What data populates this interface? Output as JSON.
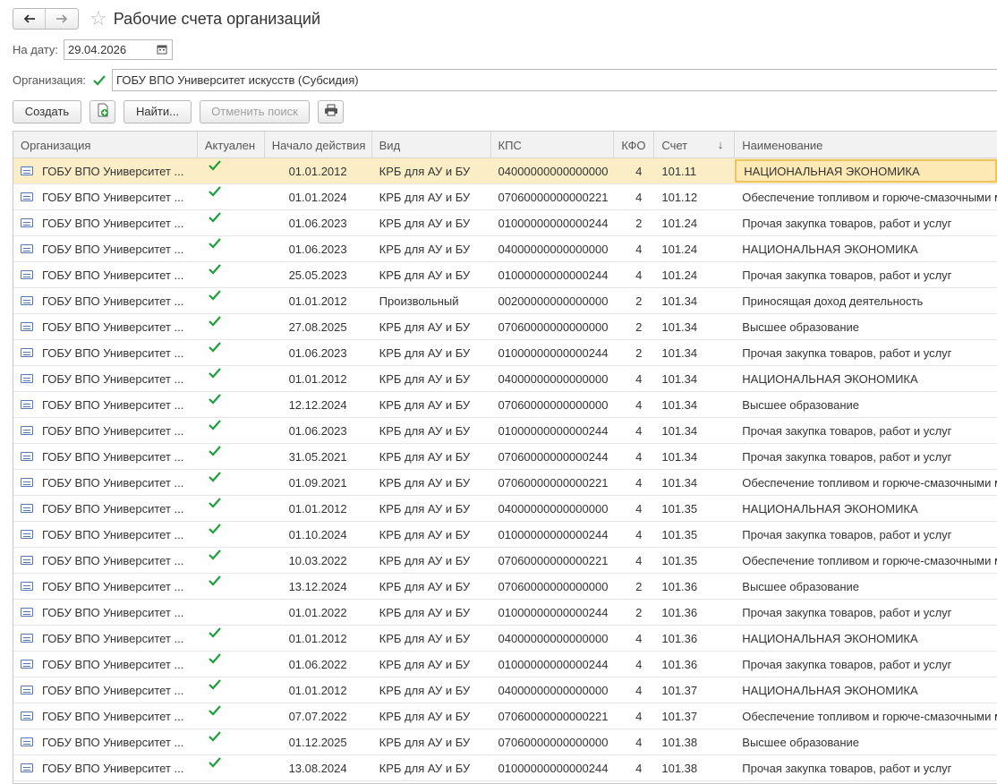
{
  "window": {
    "title": "Рабочие счета организаций"
  },
  "filters": {
    "date_label": "На дату:",
    "date_value": "29.04.2026",
    "org_label": "Организация:",
    "org_value": "ГОБУ ВПО Университет искусств (Субсидия)"
  },
  "toolbar": {
    "create_label": "Создать",
    "find_label": "Найти...",
    "cancel_search_label": "Отменить поиск"
  },
  "table": {
    "columns": [
      "Организация",
      "Актуален",
      "Начало действия",
      "Вид",
      "КПС",
      "КФО",
      "Счет",
      "Наименование"
    ],
    "sort_indicator": "↓",
    "rows": [
      {
        "org": "ГОБУ ВПО Университет ...",
        "active": true,
        "date": "01.01.2012",
        "vid": "КРБ для АУ и БУ",
        "kps": "04000000000000000",
        "kfo": "4",
        "acc": "101.11",
        "name": "НАЦИОНАЛЬНАЯ ЭКОНОМИКА"
      },
      {
        "org": "ГОБУ ВПО Университет ...",
        "active": true,
        "date": "01.01.2024",
        "vid": "КРБ для АУ и БУ",
        "kps": "07060000000000221",
        "kfo": "4",
        "acc": "101.12",
        "name": "Обеспечение топливом и горюче-смазочными м"
      },
      {
        "org": "ГОБУ ВПО Университет ...",
        "active": true,
        "date": "01.06.2023",
        "vid": "КРБ для АУ и БУ",
        "kps": "01000000000000244",
        "kfo": "2",
        "acc": "101.24",
        "name": "Прочая закупка товаров, работ и услуг"
      },
      {
        "org": "ГОБУ ВПО Университет ...",
        "active": true,
        "date": "01.06.2023",
        "vid": "КРБ для АУ и БУ",
        "kps": "04000000000000000",
        "kfo": "4",
        "acc": "101.24",
        "name": "НАЦИОНАЛЬНАЯ ЭКОНОМИКА"
      },
      {
        "org": "ГОБУ ВПО Университет ...",
        "active": true,
        "date": "25.05.2023",
        "vid": "КРБ для АУ и БУ",
        "kps": "01000000000000244",
        "kfo": "4",
        "acc": "101.24",
        "name": "Прочая закупка товаров, работ и услуг"
      },
      {
        "org": "ГОБУ ВПО Университет ...",
        "active": true,
        "date": "01.01.2012",
        "vid": "Произвольный",
        "kps": "00200000000000000",
        "kfo": "2",
        "acc": "101.34",
        "name": "Приносящая доход деятельность"
      },
      {
        "org": "ГОБУ ВПО Университет ...",
        "active": true,
        "date": "27.08.2025",
        "vid": "КРБ для АУ и БУ",
        "kps": "07060000000000000",
        "kfo": "2",
        "acc": "101.34",
        "name": "Высшее образование"
      },
      {
        "org": "ГОБУ ВПО Университет ...",
        "active": true,
        "date": "01.06.2023",
        "vid": "КРБ для АУ и БУ",
        "kps": "01000000000000244",
        "kfo": "2",
        "acc": "101.34",
        "name": "Прочая закупка товаров, работ и услуг"
      },
      {
        "org": "ГОБУ ВПО Университет ...",
        "active": true,
        "date": "01.01.2012",
        "vid": "КРБ для АУ и БУ",
        "kps": "04000000000000000",
        "kfo": "4",
        "acc": "101.34",
        "name": "НАЦИОНАЛЬНАЯ ЭКОНОМИКА"
      },
      {
        "org": "ГОБУ ВПО Университет ...",
        "active": true,
        "date": "12.12.2024",
        "vid": "КРБ для АУ и БУ",
        "kps": "07060000000000000",
        "kfo": "4",
        "acc": "101.34",
        "name": "Высшее образование"
      },
      {
        "org": "ГОБУ ВПО Университет ...",
        "active": true,
        "date": "01.06.2023",
        "vid": "КРБ для АУ и БУ",
        "kps": "01000000000000244",
        "kfo": "4",
        "acc": "101.34",
        "name": "Прочая закупка товаров, работ и услуг"
      },
      {
        "org": "ГОБУ ВПО Университет ...",
        "active": true,
        "date": "31.05.2021",
        "vid": "КРБ для АУ и БУ",
        "kps": "07060000000000244",
        "kfo": "4",
        "acc": "101.34",
        "name": "Прочая закупка товаров, работ и услуг"
      },
      {
        "org": "ГОБУ ВПО Университет ...",
        "active": true,
        "date": "01.09.2021",
        "vid": "КРБ для АУ и БУ",
        "kps": "07060000000000221",
        "kfo": "4",
        "acc": "101.34",
        "name": "Обеспечение топливом и горюче-смазочными м"
      },
      {
        "org": "ГОБУ ВПО Университет ...",
        "active": true,
        "date": "01.01.2012",
        "vid": "КРБ для АУ и БУ",
        "kps": "04000000000000000",
        "kfo": "4",
        "acc": "101.35",
        "name": "НАЦИОНАЛЬНАЯ ЭКОНОМИКА"
      },
      {
        "org": "ГОБУ ВПО Университет ...",
        "active": true,
        "date": "01.10.2024",
        "vid": "КРБ для АУ и БУ",
        "kps": "01000000000000244",
        "kfo": "4",
        "acc": "101.35",
        "name": "Прочая закупка товаров, работ и услуг"
      },
      {
        "org": "ГОБУ ВПО Университет ...",
        "active": true,
        "date": "10.03.2022",
        "vid": "КРБ для АУ и БУ",
        "kps": "07060000000000221",
        "kfo": "4",
        "acc": "101.35",
        "name": "Обеспечение топливом и горюче-смазочными м"
      },
      {
        "org": "ГОБУ ВПО Университет ...",
        "active": true,
        "date": "13.12.2024",
        "vid": "КРБ для АУ и БУ",
        "kps": "07060000000000000",
        "kfo": "2",
        "acc": "101.36",
        "name": "Высшее образование"
      },
      {
        "org": "ГОБУ ВПО Университет ...",
        "active": false,
        "date": "01.01.2022",
        "vid": "КРБ для АУ и БУ",
        "kps": "01000000000000244",
        "kfo": "2",
        "acc": "101.36",
        "name": "Прочая закупка товаров, работ и услуг"
      },
      {
        "org": "ГОБУ ВПО Университет ...",
        "active": true,
        "date": "01.01.2012",
        "vid": "КРБ для АУ и БУ",
        "kps": "04000000000000000",
        "kfo": "4",
        "acc": "101.36",
        "name": "НАЦИОНАЛЬНАЯ ЭКОНОМИКА"
      },
      {
        "org": "ГОБУ ВПО Университет ...",
        "active": true,
        "date": "01.06.2022",
        "vid": "КРБ для АУ и БУ",
        "kps": "01000000000000244",
        "kfo": "4",
        "acc": "101.36",
        "name": "Прочая закупка товаров, работ и услуг"
      },
      {
        "org": "ГОБУ ВПО Университет ...",
        "active": true,
        "date": "01.01.2012",
        "vid": "КРБ для АУ и БУ",
        "kps": "04000000000000000",
        "kfo": "4",
        "acc": "101.37",
        "name": "НАЦИОНАЛЬНАЯ ЭКОНОМИКА"
      },
      {
        "org": "ГОБУ ВПО Университет ...",
        "active": true,
        "date": "07.07.2022",
        "vid": "КРБ для АУ и БУ",
        "kps": "07060000000000221",
        "kfo": "4",
        "acc": "101.37",
        "name": "Обеспечение топливом и горюче-смазочными м"
      },
      {
        "org": "ГОБУ ВПО Университет ...",
        "active": true,
        "date": "01.12.2025",
        "vid": "КРБ для АУ и БУ",
        "kps": "07060000000000000",
        "kfo": "4",
        "acc": "101.38",
        "name": "Высшее образование"
      },
      {
        "org": "ГОБУ ВПО Университет ...",
        "active": true,
        "date": "13.08.2024",
        "vid": "КРБ для АУ и БУ",
        "kps": "01000000000000244",
        "kfo": "4",
        "acc": "101.38",
        "name": "Прочая закупка товаров, работ и услуг"
      }
    ]
  },
  "icons": {
    "back": "arrow-left-icon",
    "forward": "arrow-right-icon",
    "favorite": "star-icon",
    "calendar": "calendar-icon",
    "check": "checkmark-icon",
    "copy_add": "add-copy-icon",
    "print": "printer-icon",
    "row": "account-row-icon"
  },
  "colors": {
    "accent_check": "#1e9e3c",
    "selected_row": "#fbeec6",
    "focused_cell": "#fde9b4"
  }
}
